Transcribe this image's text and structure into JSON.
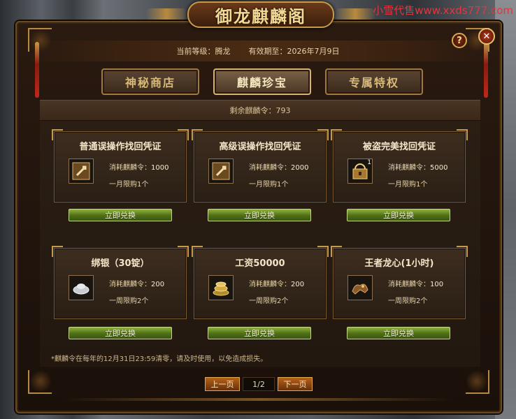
{
  "watermark": "小雪代售www.xxds777.com",
  "window": {
    "title": "御龙麒麟阁",
    "help_label": "?",
    "close_label": "✕"
  },
  "header": {
    "level_label": "当前等级：",
    "level_value": "腾龙",
    "expiry_label": "有效期至：",
    "expiry_value": "2026年7月9日"
  },
  "tabs": [
    {
      "label": "神秘商店",
      "active": false
    },
    {
      "label": "麒麟珍宝",
      "active": true
    },
    {
      "label": "专属特权",
      "active": false
    }
  ],
  "remain": {
    "label": "剩余麒麟令：",
    "value": "793"
  },
  "items": [
    {
      "title": "普通误操作找回凭证",
      "icon": "wrench-scroll-icon",
      "cost_label": "消耗麒麟令：",
      "cost": "1000",
      "limit": "一月限购1个",
      "button": "立即兑换"
    },
    {
      "title": "高级误操作找回凭证",
      "icon": "wrench-scroll-icon",
      "cost_label": "消耗麒麟令：",
      "cost": "2000",
      "limit": "一月限购1个",
      "button": "立即兑换"
    },
    {
      "title": "被盗完美找回凭证",
      "icon": "treasure-box-icon",
      "icon_badge": "1",
      "cost_label": "消耗麒麟令：",
      "cost": "5000",
      "limit": "一月限购1个",
      "button": "立即兑换"
    },
    {
      "title": "绑银（30锭）",
      "icon": "silver-ingot-icon",
      "cost_label": "消耗麒麟令：",
      "cost": "200",
      "limit": "一周限购2个",
      "button": "立即兑换"
    },
    {
      "title": "工资50000",
      "icon": "gold-coins-icon",
      "cost_label": "消耗麒麟令：",
      "cost": "200",
      "limit": "一周限购2个",
      "button": "立即兑换"
    },
    {
      "title": "王者龙心(1小时)",
      "icon": "dragon-heart-icon",
      "cost_label": "消耗麒麟令：",
      "cost": "100",
      "limit": "一周限购2个",
      "button": "立即兑换"
    }
  ],
  "note": "*麒麟令在每年的12月31日23:59清零，请及时使用，以免造成损失。",
  "pager": {
    "prev": "上一页",
    "page": "1/2",
    "next": "下一页"
  }
}
